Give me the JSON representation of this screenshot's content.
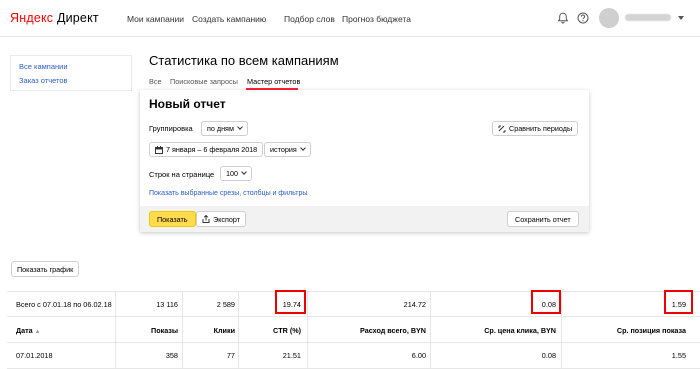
{
  "header": {
    "logo_yandex": "Яндекс",
    "logo_direct": "Директ",
    "nav": [
      "Мои кампании",
      "Создать кампанию",
      "Подбор слов",
      "Прогноз бюджета"
    ]
  },
  "sidebar": {
    "items": [
      "Все кампании",
      "Заказ отчетов"
    ]
  },
  "page": {
    "title": "Статистика по всем кампаниям",
    "tabs": [
      "Все",
      "Поисковые запросы",
      "Мастер отчетов"
    ],
    "active_tab": "Мастер отчетов"
  },
  "report": {
    "title": "Новый отчет",
    "grouping_label": "Группировка",
    "grouping_value": "по дням",
    "compare_label": "Сравнить периоды",
    "date_range": "7 января – 6 февраля 2018",
    "history_value": "история",
    "rows_label": "Строк на странице",
    "rows_value": "100",
    "slices_link": "Показать выбранные срезы, столбцы и фильтры",
    "show_button": "Показать",
    "export_button": "Экспорт",
    "save_button": "Сохранить отчет"
  },
  "show_chart_button": "Показать график",
  "table": {
    "total": [
      "Всего с 07.01.18 по 06.02.18",
      "13 116",
      "2 589",
      "19.74",
      "214.72",
      "0.08",
      "1.59"
    ],
    "headers": [
      "Дата",
      "Показы",
      "Клики",
      "CTR (%)",
      "Расход всего, BYN",
      "Ср. цена клика, BYN",
      "Ср. позиция показа"
    ],
    "sort_indicator": "▲",
    "rows": [
      [
        "07.01.2018",
        "358",
        "77",
        "21.51",
        "6.00",
        "0.08",
        "1.55"
      ]
    ]
  },
  "colors": {
    "accent_red": "#ff0000",
    "link_blue": "#2a5ec7",
    "button_yellow": "#ffdb4d",
    "highlight_box": "#e00000"
  }
}
